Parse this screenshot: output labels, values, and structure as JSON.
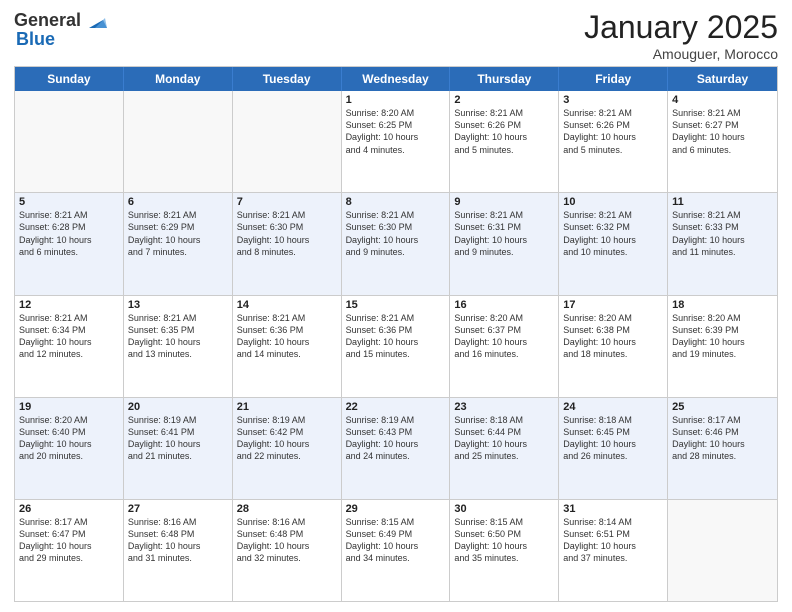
{
  "header": {
    "logo_general": "General",
    "logo_blue": "Blue",
    "month_title": "January 2025",
    "subtitle": "Amouguer, Morocco"
  },
  "weekdays": [
    "Sunday",
    "Monday",
    "Tuesday",
    "Wednesday",
    "Thursday",
    "Friday",
    "Saturday"
  ],
  "rows": [
    {
      "cells": [
        {
          "day": "",
          "info": ""
        },
        {
          "day": "",
          "info": ""
        },
        {
          "day": "",
          "info": ""
        },
        {
          "day": "1",
          "info": "Sunrise: 8:20 AM\nSunset: 6:25 PM\nDaylight: 10 hours\nand 4 minutes."
        },
        {
          "day": "2",
          "info": "Sunrise: 8:21 AM\nSunset: 6:26 PM\nDaylight: 10 hours\nand 5 minutes."
        },
        {
          "day": "3",
          "info": "Sunrise: 8:21 AM\nSunset: 6:26 PM\nDaylight: 10 hours\nand 5 minutes."
        },
        {
          "day": "4",
          "info": "Sunrise: 8:21 AM\nSunset: 6:27 PM\nDaylight: 10 hours\nand 6 minutes."
        }
      ]
    },
    {
      "cells": [
        {
          "day": "5",
          "info": "Sunrise: 8:21 AM\nSunset: 6:28 PM\nDaylight: 10 hours\nand 6 minutes."
        },
        {
          "day": "6",
          "info": "Sunrise: 8:21 AM\nSunset: 6:29 PM\nDaylight: 10 hours\nand 7 minutes."
        },
        {
          "day": "7",
          "info": "Sunrise: 8:21 AM\nSunset: 6:30 PM\nDaylight: 10 hours\nand 8 minutes."
        },
        {
          "day": "8",
          "info": "Sunrise: 8:21 AM\nSunset: 6:30 PM\nDaylight: 10 hours\nand 9 minutes."
        },
        {
          "day": "9",
          "info": "Sunrise: 8:21 AM\nSunset: 6:31 PM\nDaylight: 10 hours\nand 9 minutes."
        },
        {
          "day": "10",
          "info": "Sunrise: 8:21 AM\nSunset: 6:32 PM\nDaylight: 10 hours\nand 10 minutes."
        },
        {
          "day": "11",
          "info": "Sunrise: 8:21 AM\nSunset: 6:33 PM\nDaylight: 10 hours\nand 11 minutes."
        }
      ]
    },
    {
      "cells": [
        {
          "day": "12",
          "info": "Sunrise: 8:21 AM\nSunset: 6:34 PM\nDaylight: 10 hours\nand 12 minutes."
        },
        {
          "day": "13",
          "info": "Sunrise: 8:21 AM\nSunset: 6:35 PM\nDaylight: 10 hours\nand 13 minutes."
        },
        {
          "day": "14",
          "info": "Sunrise: 8:21 AM\nSunset: 6:36 PM\nDaylight: 10 hours\nand 14 minutes."
        },
        {
          "day": "15",
          "info": "Sunrise: 8:21 AM\nSunset: 6:36 PM\nDaylight: 10 hours\nand 15 minutes."
        },
        {
          "day": "16",
          "info": "Sunrise: 8:20 AM\nSunset: 6:37 PM\nDaylight: 10 hours\nand 16 minutes."
        },
        {
          "day": "17",
          "info": "Sunrise: 8:20 AM\nSunset: 6:38 PM\nDaylight: 10 hours\nand 18 minutes."
        },
        {
          "day": "18",
          "info": "Sunrise: 8:20 AM\nSunset: 6:39 PM\nDaylight: 10 hours\nand 19 minutes."
        }
      ]
    },
    {
      "cells": [
        {
          "day": "19",
          "info": "Sunrise: 8:20 AM\nSunset: 6:40 PM\nDaylight: 10 hours\nand 20 minutes."
        },
        {
          "day": "20",
          "info": "Sunrise: 8:19 AM\nSunset: 6:41 PM\nDaylight: 10 hours\nand 21 minutes."
        },
        {
          "day": "21",
          "info": "Sunrise: 8:19 AM\nSunset: 6:42 PM\nDaylight: 10 hours\nand 22 minutes."
        },
        {
          "day": "22",
          "info": "Sunrise: 8:19 AM\nSunset: 6:43 PM\nDaylight: 10 hours\nand 24 minutes."
        },
        {
          "day": "23",
          "info": "Sunrise: 8:18 AM\nSunset: 6:44 PM\nDaylight: 10 hours\nand 25 minutes."
        },
        {
          "day": "24",
          "info": "Sunrise: 8:18 AM\nSunset: 6:45 PM\nDaylight: 10 hours\nand 26 minutes."
        },
        {
          "day": "25",
          "info": "Sunrise: 8:17 AM\nSunset: 6:46 PM\nDaylight: 10 hours\nand 28 minutes."
        }
      ]
    },
    {
      "cells": [
        {
          "day": "26",
          "info": "Sunrise: 8:17 AM\nSunset: 6:47 PM\nDaylight: 10 hours\nand 29 minutes."
        },
        {
          "day": "27",
          "info": "Sunrise: 8:16 AM\nSunset: 6:48 PM\nDaylight: 10 hours\nand 31 minutes."
        },
        {
          "day": "28",
          "info": "Sunrise: 8:16 AM\nSunset: 6:48 PM\nDaylight: 10 hours\nand 32 minutes."
        },
        {
          "day": "29",
          "info": "Sunrise: 8:15 AM\nSunset: 6:49 PM\nDaylight: 10 hours\nand 34 minutes."
        },
        {
          "day": "30",
          "info": "Sunrise: 8:15 AM\nSunset: 6:50 PM\nDaylight: 10 hours\nand 35 minutes."
        },
        {
          "day": "31",
          "info": "Sunrise: 8:14 AM\nSunset: 6:51 PM\nDaylight: 10 hours\nand 37 minutes."
        },
        {
          "day": "",
          "info": ""
        }
      ]
    }
  ]
}
